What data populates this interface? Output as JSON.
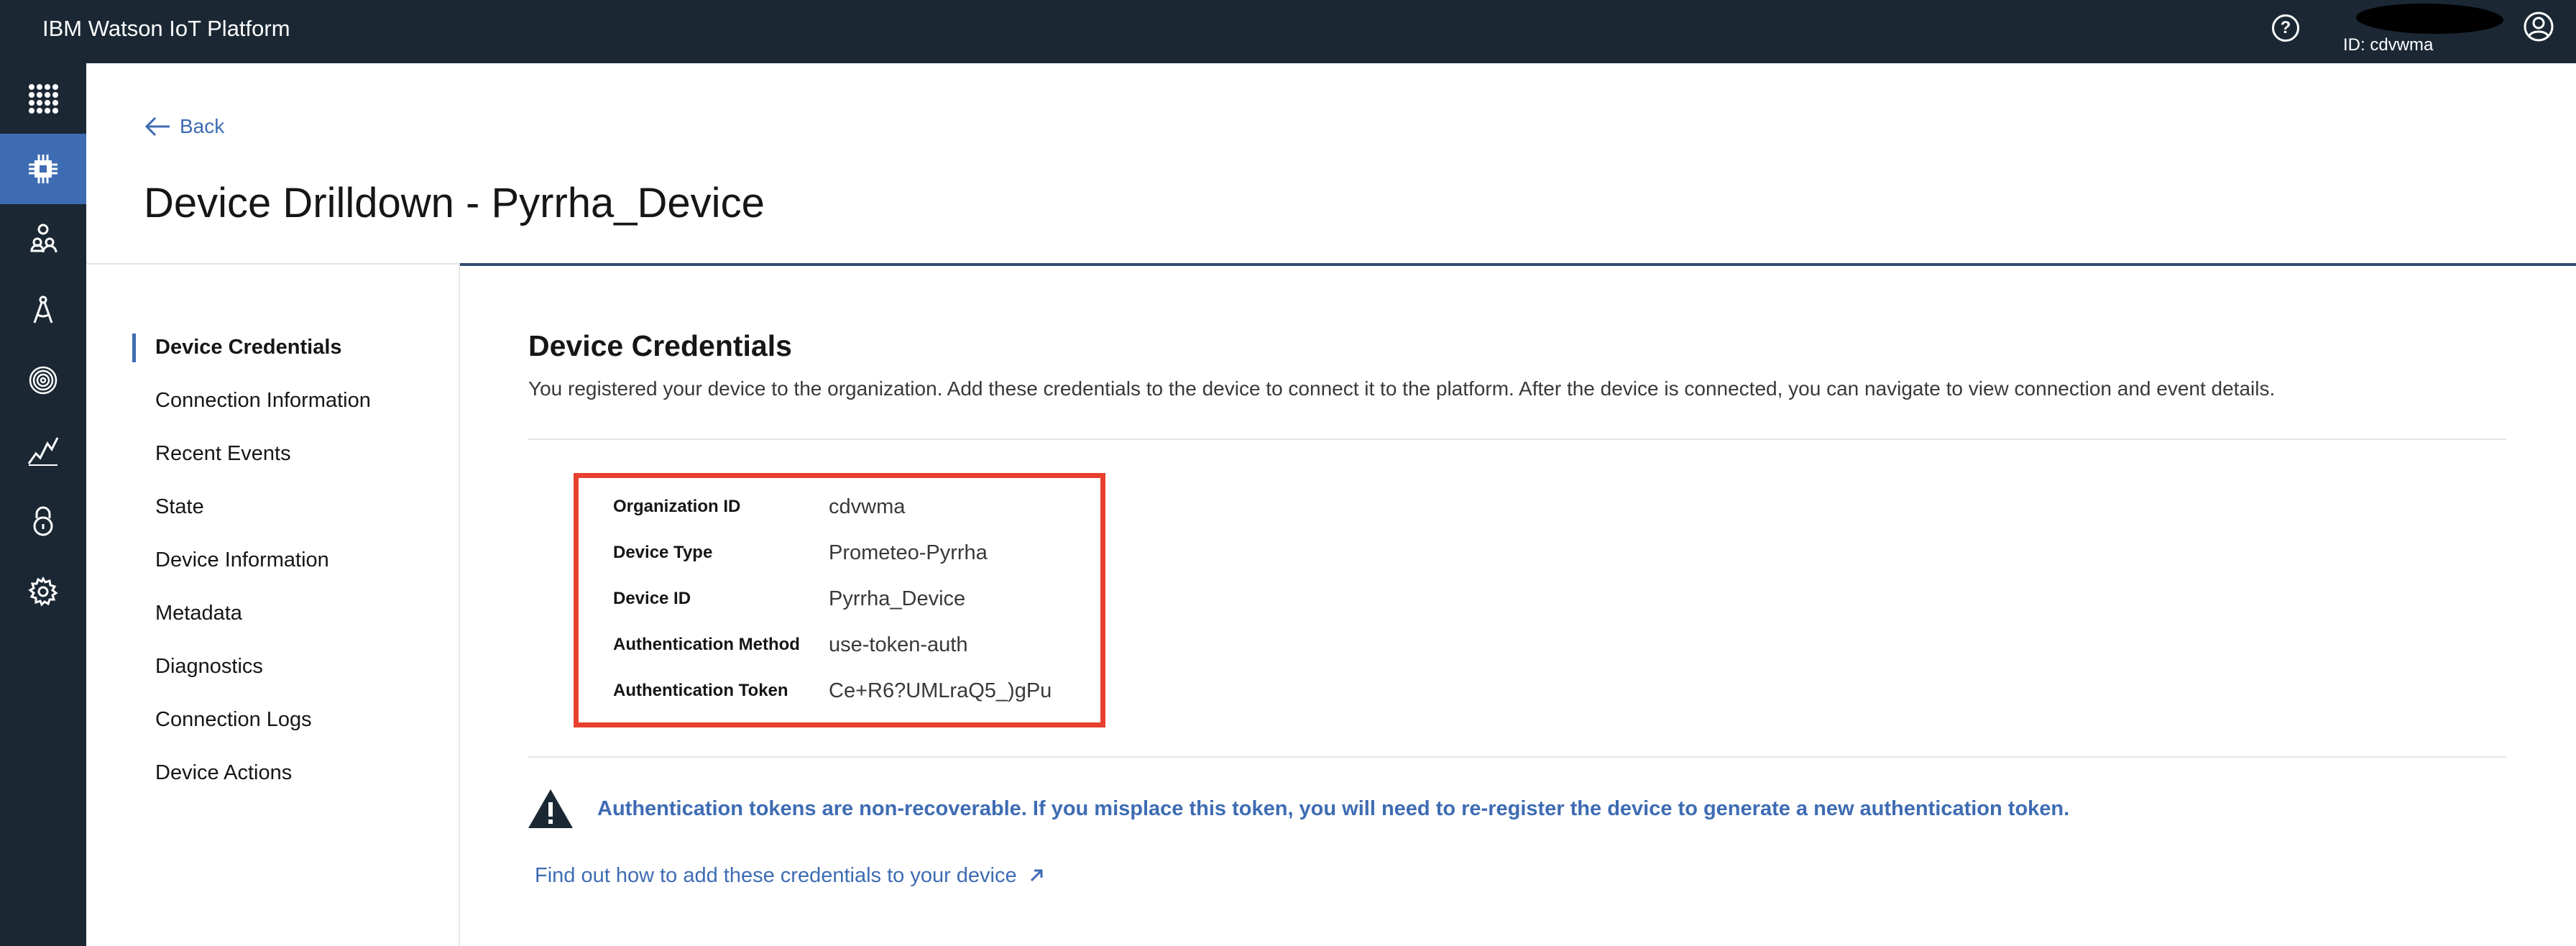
{
  "header": {
    "brand": "IBM Watson IoT Platform",
    "org_label": "ID: cdvwma",
    "help_icon": "help-circle-icon",
    "user_icon": "user-avatar-icon"
  },
  "rail": {
    "items": [
      {
        "icon": "app-switcher-icon",
        "active": false
      },
      {
        "icon": "devices-chip-icon",
        "active": true
      },
      {
        "icon": "members-icon",
        "active": false
      },
      {
        "icon": "apps-compass-icon",
        "active": false
      },
      {
        "icon": "rules-fingerprint-icon",
        "active": false
      },
      {
        "icon": "usage-chart-icon",
        "active": false
      },
      {
        "icon": "security-lock-icon",
        "active": false
      },
      {
        "icon": "settings-gear-icon",
        "active": false
      }
    ]
  },
  "page": {
    "back_label": "Back",
    "title": "Device Drilldown - Pyrrha_Device"
  },
  "subnav": {
    "items": [
      {
        "label": "Device Credentials",
        "active": true
      },
      {
        "label": "Connection Information",
        "active": false
      },
      {
        "label": "Recent Events",
        "active": false
      },
      {
        "label": "State",
        "active": false
      },
      {
        "label": "Device Information",
        "active": false
      },
      {
        "label": "Metadata",
        "active": false
      },
      {
        "label": "Diagnostics",
        "active": false
      },
      {
        "label": "Connection Logs",
        "active": false
      },
      {
        "label": "Device Actions",
        "active": false
      }
    ]
  },
  "credentials": {
    "title": "Device Credentials",
    "description": "You registered your device to the organization. Add these credentials to the device to connect it to the platform. After the device is connected, you can navigate to view connection and event details.",
    "rows": [
      {
        "key": "Organization ID",
        "value": "cdvwma"
      },
      {
        "key": "Device Type",
        "value": "Prometeo-Pyrrha"
      },
      {
        "key": "Device ID",
        "value": "Pyrrha_Device"
      },
      {
        "key": "Authentication Method",
        "value": "use-token-auth"
      },
      {
        "key": "Authentication Token",
        "value": "Ce+R6?UMLraQ5_)gPu"
      }
    ],
    "warning": "Authentication tokens are non-recoverable. If you misplace this token, you will need to re-register the device to generate a new authentication token.",
    "help_link": "Find out how to add these credentials to your device"
  },
  "colors": {
    "header_bg": "#1b2834",
    "accent": "#3e6cb3",
    "highlight_border": "#e8402f"
  }
}
